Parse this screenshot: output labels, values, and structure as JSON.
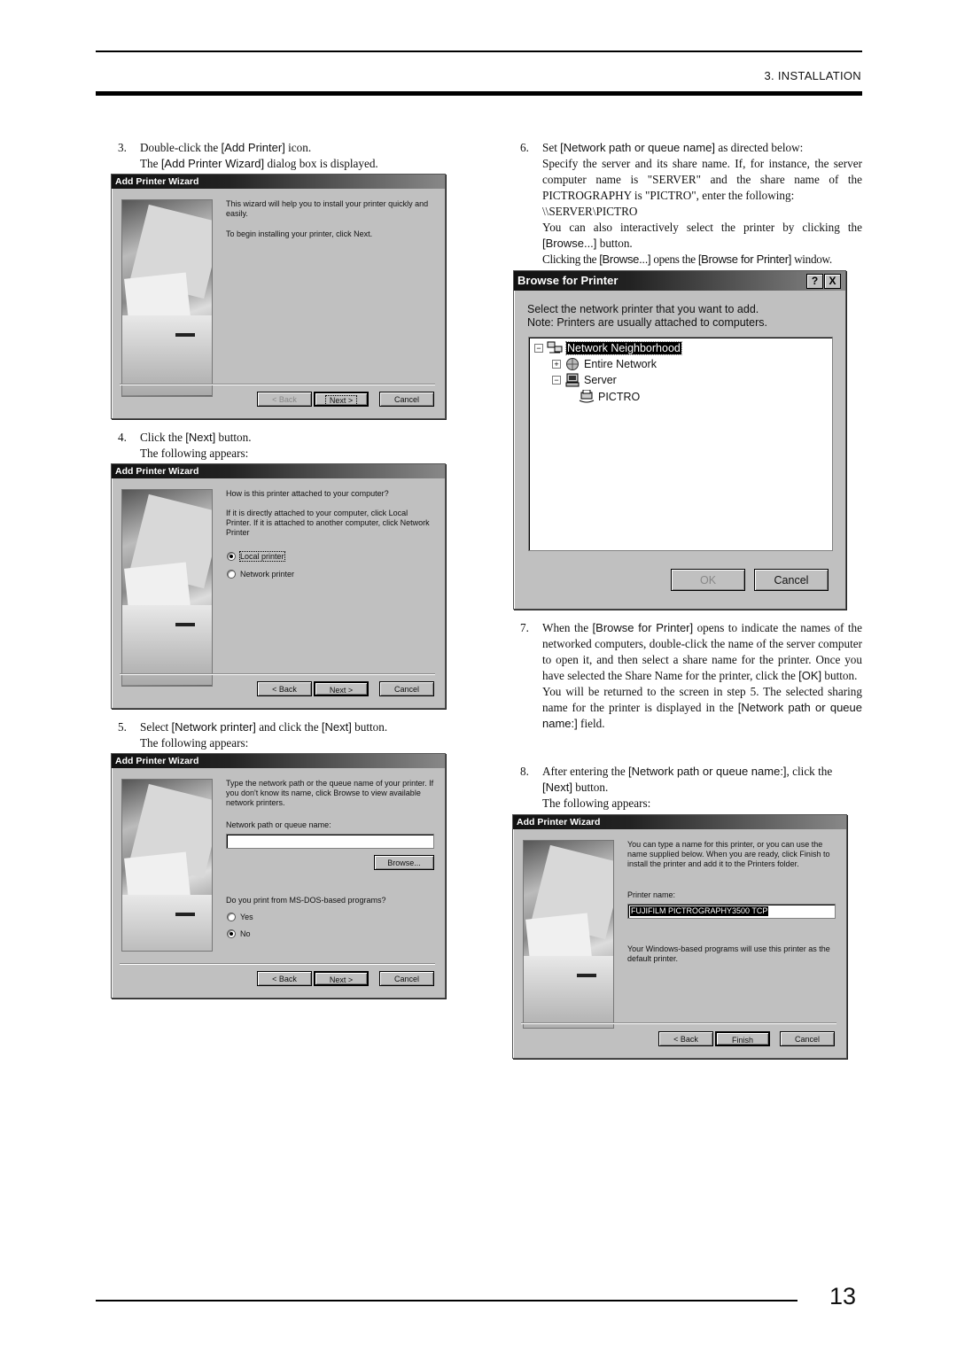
{
  "header": {
    "section": "3. INSTALLATION"
  },
  "footer": {
    "page_number": "13"
  },
  "steps": {
    "s3": {
      "num": "3.",
      "line1_pre": "Double-click the ",
      "line1_ui": "[Add Printer]",
      "line1_post": " icon.",
      "line2_pre": "The ",
      "line2_ui": "[Add Printer Wizard]",
      "line2_post": " dialog box is displayed."
    },
    "s4": {
      "num": "4.",
      "line1_pre": "Click the ",
      "line1_ui": "[Next]",
      "line1_post": " button.",
      "line2": "The following appears:"
    },
    "s5": {
      "num": "5.",
      "line1_pre": "Select ",
      "line1_ui": "[Network printer]",
      "line1_mid": " and click the ",
      "line1_ui2": "[Next]",
      "line1_post": " button.",
      "line2": "The following appears:"
    },
    "s6": {
      "num": "6.",
      "line1_pre": "Set ",
      "line1_ui": "[Network path or queue name]",
      "line1_post": " as directed below:",
      "para1": "Specify the server and its share name.  If, for instance, the server computer name is \"SERVER\" and the share name of the PICTROGRAPHY is \"PICTRO\", enter the following:",
      "path": "\\\\SERVER\\PICTRO",
      "para2_pre": "You can also interactively select the printer by clicking the ",
      "para2_ui": "[Browse...]",
      "para2_post": " button.",
      "para3_pre": "Clicking the ",
      "para3_ui": "[Browse...]",
      "para3_mid": " opens the ",
      "para3_ui2": "[Browse for Printer]",
      "para3_post": " window."
    },
    "s7": {
      "num": "7.",
      "para1_pre": "When the ",
      "para1_ui": "[Browse for Printer]",
      "para1_post": " opens to indicate the names of the networked computers, double-click the name of the server computer to open it, and then select a share name for the printer. Once you have selected the Share Name for the printer, click the ",
      "para1_ui2": "[OK]",
      "para1_end": " button.",
      "para2_pre": "You will be returned to the screen in step 5. The selected sharing name for the printer is displayed in the ",
      "para2_ui": "[Network path or queue name:]",
      "para2_post": " field."
    },
    "s8": {
      "num": "8.",
      "line1_pre": "After entering the ",
      "line1_ui": "[Network path or queue name:]",
      "line1_post": ", click the ",
      "line2_ui": "[Next]",
      "line2_post": " button.",
      "line3": "The following appears:"
    }
  },
  "dialog1": {
    "title": "Add Printer Wizard",
    "text1": "This wizard will help you to install your printer quickly and easily.",
    "text2": "To begin installing your printer, click Next.",
    "back": "< Back",
    "next": "Next >",
    "cancel": "Cancel"
  },
  "dialog2": {
    "title": "Add Printer Wizard",
    "question": "How is this printer attached to your computer?",
    "explain": "If it is directly attached to your computer, click Local Printer. If it is attached to another computer, click Network Printer",
    "options": [
      {
        "label": "Local printer",
        "selected": true
      },
      {
        "label": "Network printer",
        "selected": false
      }
    ],
    "back": "< Back",
    "next": "Next >",
    "cancel": "Cancel"
  },
  "dialog3": {
    "title": "Add Printer Wizard",
    "text": "Type the network path or the queue name of your printer. If you don't know its name, click Browse to view available network printers.",
    "field_label": "Network path or queue name:",
    "field_value": "",
    "browse": "Browse...",
    "dos_question": "Do you print from MS-DOS-based programs?",
    "options": [
      {
        "label": "Yes",
        "selected": false
      },
      {
        "label": "No",
        "selected": true
      }
    ],
    "back": "< Back",
    "next": "Next >",
    "cancel": "Cancel"
  },
  "browse_dialog": {
    "title": "Browse for Printer",
    "help": "?",
    "close": "X",
    "instruction1": "Select the network printer that you want to add.",
    "instruction2": "Note: Printers are usually attached to computers.",
    "tree": [
      {
        "label": "Network Neighborhood",
        "icon": "network-neighborhood-icon",
        "expander": "−",
        "selected": true
      },
      {
        "label": "Entire Network",
        "icon": "globe-icon",
        "expander": "+"
      },
      {
        "label": "Server",
        "icon": "computer-icon",
        "expander": "−"
      },
      {
        "label": "PICTRO",
        "icon": "shared-printer-icon",
        "expander": ""
      }
    ],
    "ok": "OK",
    "cancel": "Cancel"
  },
  "dialog4": {
    "title": "Add Printer Wizard",
    "text": "You can type a name for this printer, or you can use the name supplied below. When you are ready, click Finish to install the printer and add it to the Printers folder.",
    "field_label": "Printer name:",
    "field_value": "FUJIFILM PICTROGRAPHY3500 TCP",
    "default_note": "Your Windows-based programs will use this printer as the default printer.",
    "back": "< Back",
    "finish": "Finish",
    "cancel": "Cancel"
  }
}
